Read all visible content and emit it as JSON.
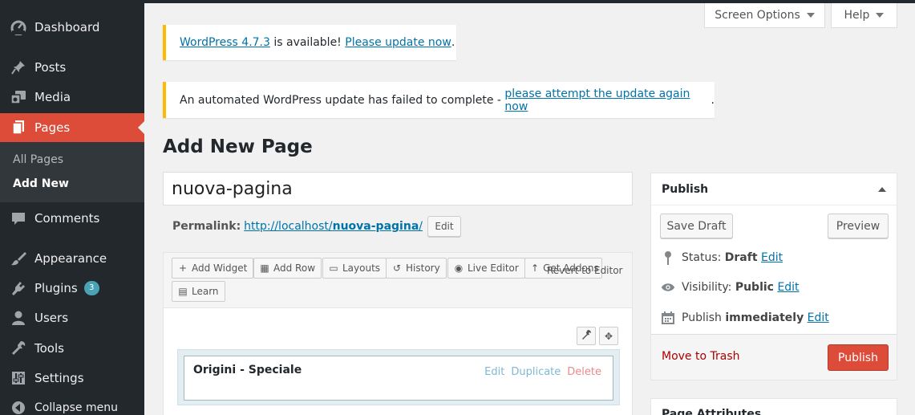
{
  "sidebar": {
    "items": [
      {
        "label": "Dashboard",
        "icon": "dashboard-icon"
      },
      {
        "label": "Posts",
        "icon": "pin-icon"
      },
      {
        "label": "Media",
        "icon": "media-icon"
      },
      {
        "label": "Pages",
        "icon": "pages-icon"
      },
      {
        "label": "Comments",
        "icon": "comment-icon"
      },
      {
        "label": "Appearance",
        "icon": "brush-icon"
      },
      {
        "label": "Plugins",
        "icon": "plugin-icon",
        "badge": "3"
      },
      {
        "label": "Users",
        "icon": "user-icon"
      },
      {
        "label": "Tools",
        "icon": "wrench-icon"
      },
      {
        "label": "Settings",
        "icon": "settings-icon"
      },
      {
        "label": "Collapse menu",
        "icon": "collapse-icon"
      }
    ],
    "submenu": [
      {
        "label": "All Pages"
      },
      {
        "label": "Add New"
      }
    ],
    "colors": {
      "background": "#23282d",
      "active": "#dd4b39",
      "badge": "#4aa3b5"
    }
  },
  "screen_meta": {
    "screen_options": "Screen Options",
    "help": "Help"
  },
  "notices": {
    "update": {
      "link": "WordPress 4.7.3",
      "text": " is available! ",
      "action": "Please update now",
      "end": "."
    },
    "failed": {
      "text": "An automated WordPress update has failed to complete - ",
      "action": "please attempt the update again now",
      "end": "."
    }
  },
  "page_title": "Add New Page",
  "editor": {
    "title_value": "nuova-pagina",
    "permalink_label": "Permalink:",
    "permalink_base": "http://localhost/",
    "permalink_slug": "nuova-pagina",
    "permalink_end": "/",
    "edit_label": "Edit"
  },
  "builder": {
    "toolbar": [
      {
        "label": "Add Widget",
        "glyph": "+"
      },
      {
        "label": "Add Row",
        "glyph": "▦"
      },
      {
        "label": "Layouts",
        "glyph": "▭"
      },
      {
        "label": "History",
        "glyph": "↺"
      },
      {
        "label": "Live Editor",
        "glyph": "◉"
      },
      {
        "label": "Get Addons",
        "glyph": "↑"
      },
      {
        "label": "Learn",
        "glyph": "▤"
      }
    ],
    "revert": "Revert to Editor",
    "row_tools": {
      "settings": "🔧",
      "move": "✥"
    },
    "widget": {
      "title": "Origini - Speciale",
      "edit": "Edit",
      "duplicate": "Duplicate",
      "delete": "Delete"
    }
  },
  "publish": {
    "title": "Publish",
    "save_draft": "Save Draft",
    "preview": "Preview",
    "status_label": "Status:",
    "status_value": "Draft",
    "visibility_label": "Visibility:",
    "visibility_value": "Public",
    "publish_label": "Publish",
    "publish_value": "immediately",
    "edit": "Edit",
    "move_to_trash": "Move to Trash",
    "publish_button": "Publish"
  },
  "page_attributes": {
    "title": "Page Attributes"
  }
}
